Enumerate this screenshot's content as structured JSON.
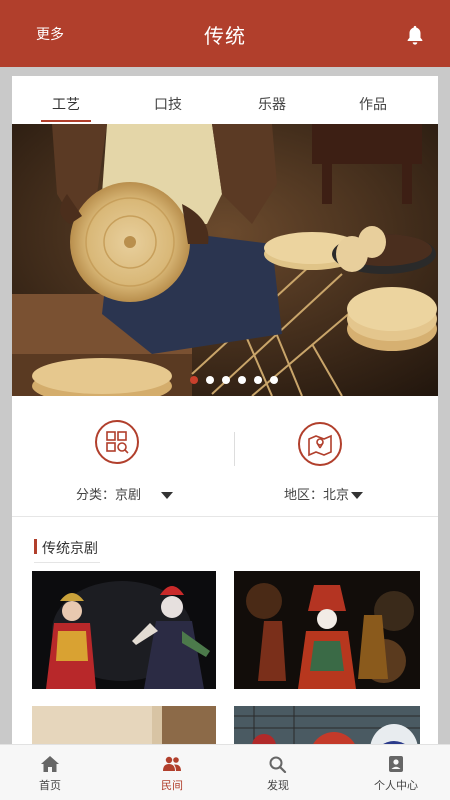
{
  "header": {
    "more_label": "更多",
    "title": "传统",
    "bell_icon": "bell-icon"
  },
  "tabs": [
    {
      "label": "工艺",
      "active": true
    },
    {
      "label": "口技",
      "active": false
    },
    {
      "label": "乐器",
      "active": false
    },
    {
      "label": "作品",
      "active": false
    }
  ],
  "banner": {
    "dots": 6,
    "active_dot": 0
  },
  "filters": {
    "category_label": "分类：京剧",
    "region_label": "地区：北京",
    "category_icon": "grid-search-icon",
    "region_icon": "map-pin-icon"
  },
  "section": {
    "title": "传统京剧"
  },
  "tabbar": [
    {
      "label": "首页",
      "icon": "home-icon",
      "active": false
    },
    {
      "label": "民间",
      "icon": "people-icon",
      "active": true
    },
    {
      "label": "发现",
      "icon": "search-icon",
      "active": false
    },
    {
      "label": "个人中心",
      "icon": "person-badge-icon",
      "active": false
    }
  ],
  "colors": {
    "accent": "#b13f2c",
    "background": "#c9c9c9",
    "card": "#ffffff"
  }
}
